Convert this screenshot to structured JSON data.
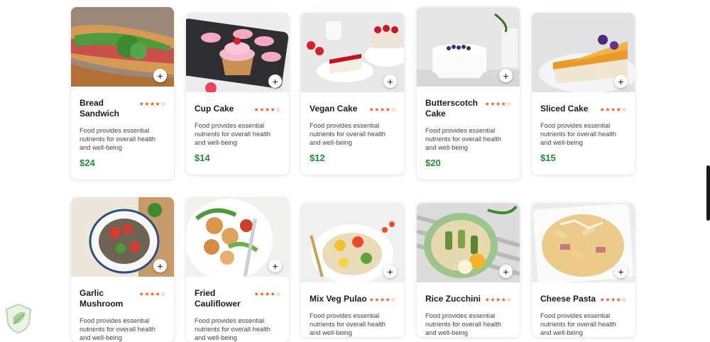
{
  "rating_stars": "★★★★☆",
  "add_symbol": "+",
  "products": [
    {
      "name": "Bread Sandwich",
      "description": "Food provides essential nutrients for overall health and well-being",
      "price": "$24"
    },
    {
      "name": "Cup Cake",
      "description": "Food provides essential nutrients for overall health and well-being",
      "price": "$14"
    },
    {
      "name": "Vegan Cake",
      "description": "Food provides essential nutrients for overall health and well-being",
      "price": "$12"
    },
    {
      "name": "Butterscotch Cake",
      "description": "Food provides essential nutrients for overall health and well-being",
      "price": "$20"
    },
    {
      "name": "Sliced Cake",
      "description": "Food provides essential nutrients for overall health and well-being",
      "price": "$15"
    },
    {
      "name": "Garlic Mushroom",
      "description": "Food provides essential nutrients for overall health and well-being",
      "price": ""
    },
    {
      "name": "Fried Cauliflower",
      "description": "Food provides essential nutrients for overall health and well-being",
      "price": ""
    },
    {
      "name": "Mix Veg Pulao",
      "description": "Food provides essential nutrients for overall health and well-being",
      "price": ""
    },
    {
      "name": "Rice Zucchini",
      "description": "Food provides essential nutrients for overall health and well-being",
      "price": ""
    },
    {
      "name": "Cheese Pasta",
      "description": "Food provides essential nutrients for overall health and well-being",
      "price": ""
    }
  ],
  "colors": {
    "price": "#218c3a",
    "stars": "#ef5a1f",
    "card_bg": "#ffffff"
  }
}
